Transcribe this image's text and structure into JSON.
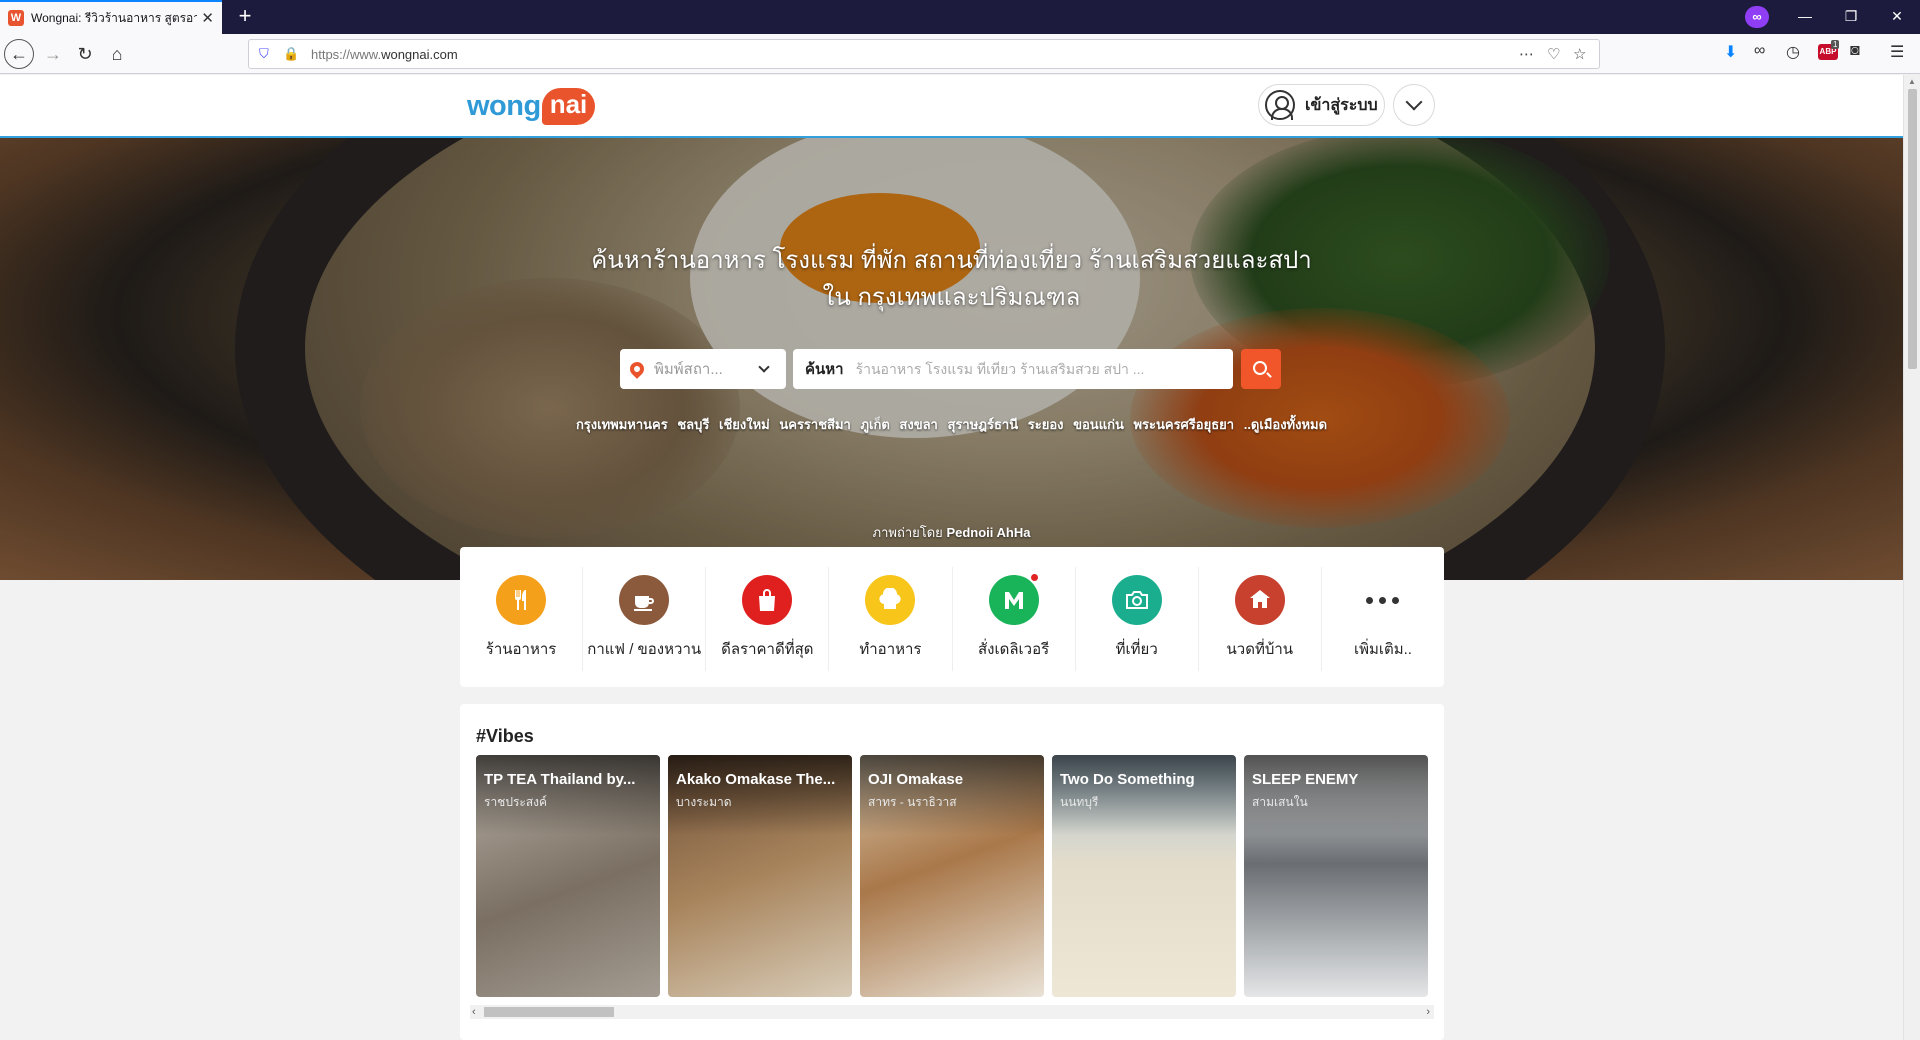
{
  "browser": {
    "tab_title": "Wongnai: รีวิวร้านอาหาร สูตรอาหาร",
    "favicon_letter": "W",
    "new_tab": "+",
    "url_prefix": "https://www.",
    "url_domain": "wongnai.com",
    "private_badge": "∞",
    "window_controls": [
      "—",
      "❐",
      "✕"
    ]
  },
  "site": {
    "logo_wong": "wong",
    "logo_nai": "nai",
    "login_label": "เข้าสู่ระบบ"
  },
  "hero": {
    "title_line1": "ค้นหาร้านอาหาร โรงแรม ที่พัก สถานที่ท่องเที่ยว ร้านเสริมสวยและสปา",
    "title_line2": "ใน กรุงเทพและปริมณฑล",
    "location_placeholder": "พิมพ์สถา...",
    "search_label": "ค้นหา",
    "search_placeholder": "ร้านอาหาร โรงแรม ที่เที่ยว ร้านเสริมสวย สปา ...",
    "cities": [
      "กรุงเทพมหานคร",
      "ชลบุรี",
      "เชียงใหม่",
      "นครราชสีมา",
      "ภูเก็ต",
      "สงขลา",
      "สุราษฎร์ธานี",
      "ระยอง",
      "ขอนแก่น",
      "พระนครศรีอยุธยา",
      "..ดูเมืองทั้งหมด"
    ],
    "photo_credit_prefix": "ภาพถ่ายโดย",
    "photo_credit_name": "Pednoii AhHa"
  },
  "categories": [
    {
      "label": "ร้านอาหาร",
      "icon": "fork-knife-icon",
      "color": "#f5a01a",
      "glyph": "🍴"
    },
    {
      "label": "กาแฟ / ของหวาน",
      "icon": "coffee-cup-icon",
      "color": "#8b5a3c",
      "glyph": "☕"
    },
    {
      "label": "ดีลราคาดีที่สุด",
      "icon": "shopping-bag-icon",
      "color": "#e0201f",
      "glyph": "🛍"
    },
    {
      "label": "ทำอาหาร",
      "icon": "chef-hat-icon",
      "color": "#f8c51a",
      "glyph": "👨‍🍳"
    },
    {
      "label": "สั่งเดลิเวอรี",
      "icon": "lineman-icon",
      "color": "#19b35a",
      "glyph": "M"
    },
    {
      "label": "ที่เที่ยว",
      "icon": "camera-icon",
      "color": "#1aae8f",
      "glyph": "📷"
    },
    {
      "label": "นวดที่บ้าน",
      "icon": "massage-home-icon",
      "color": "#c8402e",
      "glyph": "⌂"
    },
    {
      "label": "เพิ่มเติม..",
      "icon": "more-dots-icon",
      "color": "#333333",
      "glyph": ""
    }
  ],
  "vibes": {
    "title": "#Vibes",
    "items": [
      {
        "name": "TP TEA Thailand by...",
        "area": "ราชประสงค์",
        "bg": "#9a8f82"
      },
      {
        "name": "Akako Omakase The...",
        "area": "บางระมาด",
        "bg": "#8a6a48"
      },
      {
        "name": "OJI Omakase",
        "area": "สาทร - นราธิวาส",
        "bg": "#b58c62"
      },
      {
        "name": "Two Do Something",
        "area": "นนทบุรี",
        "bg": "#d8d1bf"
      },
      {
        "name": "SLEEP ENEMY",
        "area": "สามเสนใน",
        "bg": "#cfd1d3"
      }
    ]
  }
}
